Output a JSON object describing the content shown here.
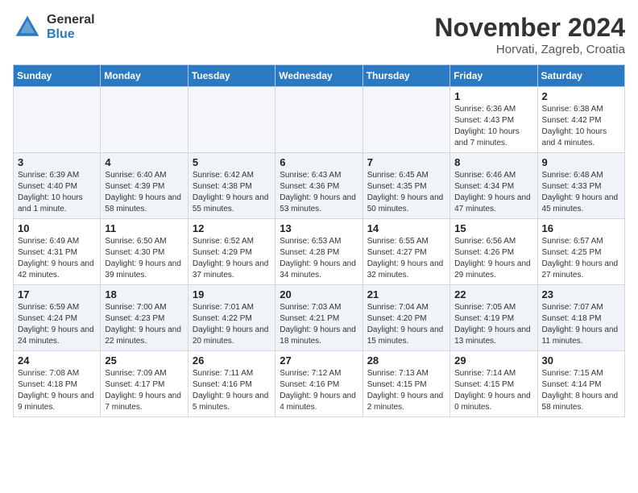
{
  "logo": {
    "general": "General",
    "blue": "Blue"
  },
  "header": {
    "month": "November 2024",
    "location": "Horvati, Zagreb, Croatia"
  },
  "weekdays": [
    "Sunday",
    "Monday",
    "Tuesday",
    "Wednesday",
    "Thursday",
    "Friday",
    "Saturday"
  ],
  "weeks": [
    [
      {
        "day": "",
        "info": ""
      },
      {
        "day": "",
        "info": ""
      },
      {
        "day": "",
        "info": ""
      },
      {
        "day": "",
        "info": ""
      },
      {
        "day": "",
        "info": ""
      },
      {
        "day": "1",
        "info": "Sunrise: 6:36 AM\nSunset: 4:43 PM\nDaylight: 10 hours\nand 7 minutes."
      },
      {
        "day": "2",
        "info": "Sunrise: 6:38 AM\nSunset: 4:42 PM\nDaylight: 10 hours\nand 4 minutes."
      }
    ],
    [
      {
        "day": "3",
        "info": "Sunrise: 6:39 AM\nSunset: 4:40 PM\nDaylight: 10 hours\nand 1 minute."
      },
      {
        "day": "4",
        "info": "Sunrise: 6:40 AM\nSunset: 4:39 PM\nDaylight: 9 hours\nand 58 minutes."
      },
      {
        "day": "5",
        "info": "Sunrise: 6:42 AM\nSunset: 4:38 PM\nDaylight: 9 hours\nand 55 minutes."
      },
      {
        "day": "6",
        "info": "Sunrise: 6:43 AM\nSunset: 4:36 PM\nDaylight: 9 hours\nand 53 minutes."
      },
      {
        "day": "7",
        "info": "Sunrise: 6:45 AM\nSunset: 4:35 PM\nDaylight: 9 hours\nand 50 minutes."
      },
      {
        "day": "8",
        "info": "Sunrise: 6:46 AM\nSunset: 4:34 PM\nDaylight: 9 hours\nand 47 minutes."
      },
      {
        "day": "9",
        "info": "Sunrise: 6:48 AM\nSunset: 4:33 PM\nDaylight: 9 hours\nand 45 minutes."
      }
    ],
    [
      {
        "day": "10",
        "info": "Sunrise: 6:49 AM\nSunset: 4:31 PM\nDaylight: 9 hours\nand 42 minutes."
      },
      {
        "day": "11",
        "info": "Sunrise: 6:50 AM\nSunset: 4:30 PM\nDaylight: 9 hours\nand 39 minutes."
      },
      {
        "day": "12",
        "info": "Sunrise: 6:52 AM\nSunset: 4:29 PM\nDaylight: 9 hours\nand 37 minutes."
      },
      {
        "day": "13",
        "info": "Sunrise: 6:53 AM\nSunset: 4:28 PM\nDaylight: 9 hours\nand 34 minutes."
      },
      {
        "day": "14",
        "info": "Sunrise: 6:55 AM\nSunset: 4:27 PM\nDaylight: 9 hours\nand 32 minutes."
      },
      {
        "day": "15",
        "info": "Sunrise: 6:56 AM\nSunset: 4:26 PM\nDaylight: 9 hours\nand 29 minutes."
      },
      {
        "day": "16",
        "info": "Sunrise: 6:57 AM\nSunset: 4:25 PM\nDaylight: 9 hours\nand 27 minutes."
      }
    ],
    [
      {
        "day": "17",
        "info": "Sunrise: 6:59 AM\nSunset: 4:24 PM\nDaylight: 9 hours\nand 24 minutes."
      },
      {
        "day": "18",
        "info": "Sunrise: 7:00 AM\nSunset: 4:23 PM\nDaylight: 9 hours\nand 22 minutes."
      },
      {
        "day": "19",
        "info": "Sunrise: 7:01 AM\nSunset: 4:22 PM\nDaylight: 9 hours\nand 20 minutes."
      },
      {
        "day": "20",
        "info": "Sunrise: 7:03 AM\nSunset: 4:21 PM\nDaylight: 9 hours\nand 18 minutes."
      },
      {
        "day": "21",
        "info": "Sunrise: 7:04 AM\nSunset: 4:20 PM\nDaylight: 9 hours\nand 15 minutes."
      },
      {
        "day": "22",
        "info": "Sunrise: 7:05 AM\nSunset: 4:19 PM\nDaylight: 9 hours\nand 13 minutes."
      },
      {
        "day": "23",
        "info": "Sunrise: 7:07 AM\nSunset: 4:18 PM\nDaylight: 9 hours\nand 11 minutes."
      }
    ],
    [
      {
        "day": "24",
        "info": "Sunrise: 7:08 AM\nSunset: 4:18 PM\nDaylight: 9 hours\nand 9 minutes."
      },
      {
        "day": "25",
        "info": "Sunrise: 7:09 AM\nSunset: 4:17 PM\nDaylight: 9 hours\nand 7 minutes."
      },
      {
        "day": "26",
        "info": "Sunrise: 7:11 AM\nSunset: 4:16 PM\nDaylight: 9 hours\nand 5 minutes."
      },
      {
        "day": "27",
        "info": "Sunrise: 7:12 AM\nSunset: 4:16 PM\nDaylight: 9 hours\nand 4 minutes."
      },
      {
        "day": "28",
        "info": "Sunrise: 7:13 AM\nSunset: 4:15 PM\nDaylight: 9 hours\nand 2 minutes."
      },
      {
        "day": "29",
        "info": "Sunrise: 7:14 AM\nSunset: 4:15 PM\nDaylight: 9 hours\nand 0 minutes."
      },
      {
        "day": "30",
        "info": "Sunrise: 7:15 AM\nSunset: 4:14 PM\nDaylight: 8 hours\nand 58 minutes."
      }
    ]
  ]
}
